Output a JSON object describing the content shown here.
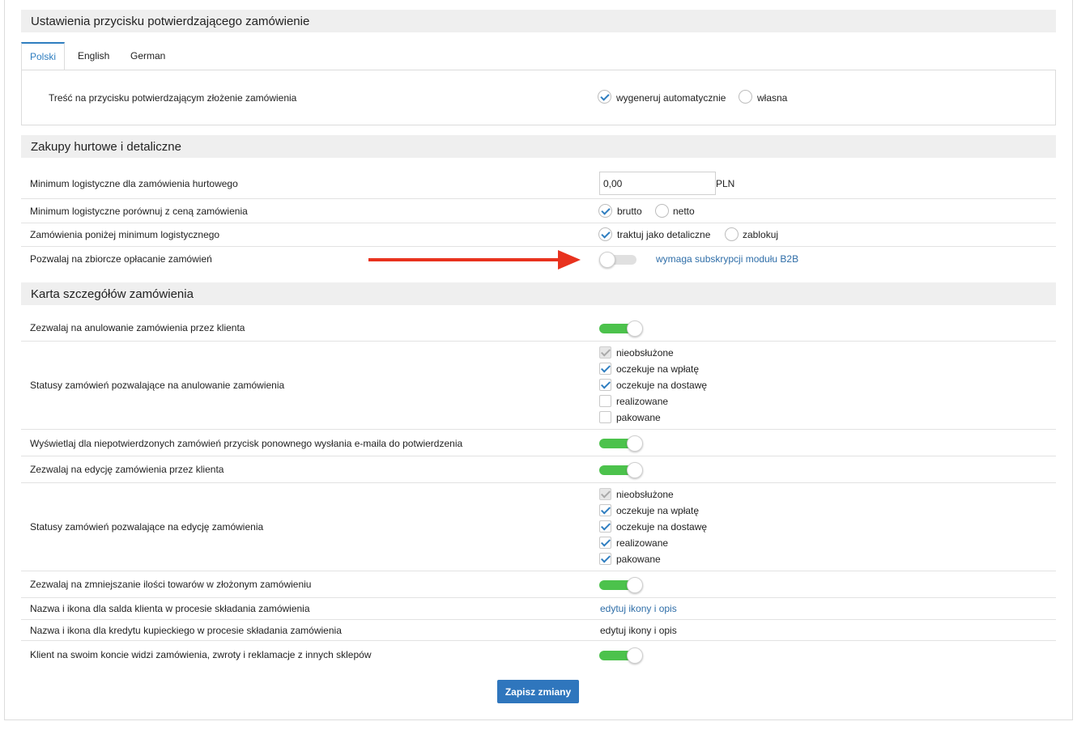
{
  "colors": {
    "accent": "#2f7ec0",
    "toggle_on": "#4cc24c",
    "arrow": "#e8321e",
    "button": "#2f76bd"
  },
  "section1": {
    "title": "Ustawienia przycisku potwierdzającego zamówienie",
    "tabs": [
      "Polski",
      "English",
      "German"
    ],
    "active_tab": "Polski",
    "row": {
      "label": "Treść na przycisku potwierdzającym złożenie zamówienia",
      "options": [
        "wygeneruj automatycznie",
        "własna"
      ],
      "selected": "wygeneruj automatycznie"
    }
  },
  "section2": {
    "title": "Zakupy hurtowe i detaliczne",
    "min_wholesale": {
      "label": "Minimum logistyczne dla zamówienia hurtowego",
      "value": "0,00",
      "unit": "PLN"
    },
    "compare_price": {
      "label": "Minimum logistyczne porównuj z ceną zamówienia",
      "options": [
        "brutto",
        "netto"
      ],
      "selected": "brutto"
    },
    "below_minimum": {
      "label": "Zamówienia poniżej minimum logistycznego",
      "options": [
        "traktuj jako detaliczne",
        "zablokuj"
      ],
      "selected": "traktuj jako detaliczne"
    },
    "bulk_payment": {
      "label": "Pozwalaj na zbiorcze opłacanie zamówień",
      "enabled": false,
      "link": "wymaga subskrypcji modułu B2B"
    }
  },
  "section3": {
    "title": "Karta szczegółów zamówienia",
    "allow_cancel": {
      "label": "Zezwalaj na anulowanie zamówienia przez klienta",
      "enabled": true
    },
    "cancel_statuses": {
      "label": "Statusy zamówień pozwalające na anulowanie zamówienia",
      "items": [
        {
          "label": "nieobsłużone",
          "checked": true,
          "disabled": true
        },
        {
          "label": "oczekuje na wpłatę",
          "checked": true,
          "disabled": false
        },
        {
          "label": "oczekuje na dostawę",
          "checked": true,
          "disabled": false
        },
        {
          "label": "realizowane",
          "checked": false,
          "disabled": false
        },
        {
          "label": "pakowane",
          "checked": false,
          "disabled": false
        }
      ]
    },
    "resend_email": {
      "label": "Wyświetlaj dla niepotwierdzonych zamówień przycisk ponownego wysłania e-maila do potwierdzenia",
      "enabled": true
    },
    "allow_edit": {
      "label": "Zezwalaj na edycję zamówienia przez klienta",
      "enabled": true
    },
    "edit_statuses": {
      "label": "Statusy zamówień pozwalające na edycję zamówienia",
      "items": [
        {
          "label": "nieobsłużone",
          "checked": true,
          "disabled": true
        },
        {
          "label": "oczekuje na wpłatę",
          "checked": true,
          "disabled": false
        },
        {
          "label": "oczekuje na dostawę",
          "checked": true,
          "disabled": false
        },
        {
          "label": "realizowane",
          "checked": true,
          "disabled": false
        },
        {
          "label": "pakowane",
          "checked": true,
          "disabled": false
        }
      ]
    },
    "reduce_qty": {
      "label": "Zezwalaj na zmniejszanie ilości towarów w złożonym zamówieniu",
      "enabled": true
    },
    "balance_icon": {
      "label": "Nazwa i ikona dla salda klienta w procesie składania zamówienia",
      "link": "edytuj ikony i opis"
    },
    "credit_icon": {
      "label": "Nazwa i ikona dla kredytu kupieckiego w procesie składania zamówienia",
      "text": "edytuj ikony i opis"
    },
    "other_shops": {
      "label": "Klient na swoim koncie widzi zamówienia, zwroty i reklamacje z innych sklepów",
      "enabled": true
    }
  },
  "save_button": "Zapisz zmiany"
}
